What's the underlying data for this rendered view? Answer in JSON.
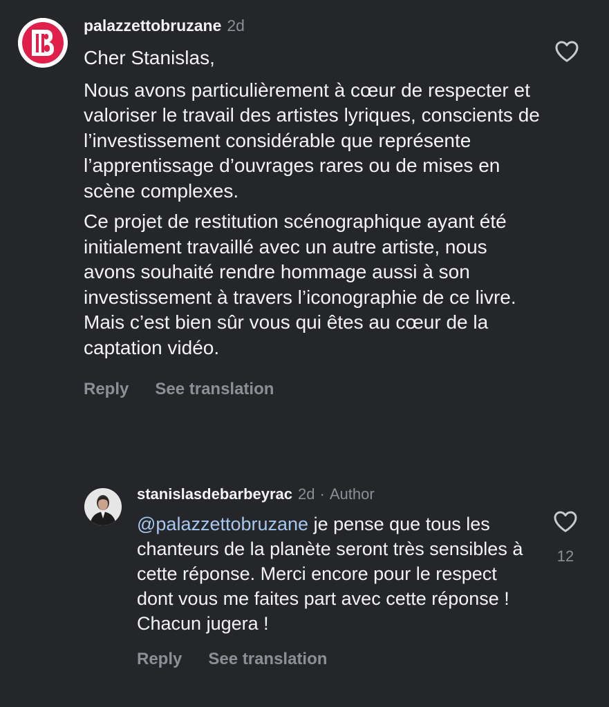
{
  "comment": {
    "username": "palazzettobruzane",
    "time": "2d",
    "paragraphs": [
      "Cher Stanislas,",
      "Nous avons particulièrement à cœur de respecter et valoriser le travail des artistes lyriques, conscients de l’investissement considérable que représente l’apprentissage d’ouvrages rares ou de mises en scène complexes.",
      "Ce projet de restitution scénographique ayant été initialement travaillé avec un autre artiste, nous avons souhaité rendre hommage aussi à son investissement à travers l’iconographie de ce livre. Mais c’est bien sûr vous qui êtes au cœur de la captation vidéo."
    ],
    "reply_label": "Reply",
    "translate_label": "See translation",
    "like_icon": "heart-outline-icon"
  },
  "reply": {
    "username": "stanislasdebarbeyrac",
    "time": "2d",
    "separator": "·",
    "author_tag": "Author",
    "mention": "@palazzettobruzane",
    "text": " je pense que tous les chanteurs de la planète seront très sensibles à cette réponse. Merci encore pour le respect dont vous me faites part avec cette réponse ! Chacun jugera !",
    "like_count": "12",
    "reply_label": "Reply",
    "translate_label": "See translation",
    "like_icon": "heart-outline-icon"
  },
  "colors": {
    "background": "#25262a",
    "text": "#f4f4f6",
    "secondary": "#8e8f96",
    "mention": "#a6c8ef",
    "brand": "#e0204a"
  }
}
